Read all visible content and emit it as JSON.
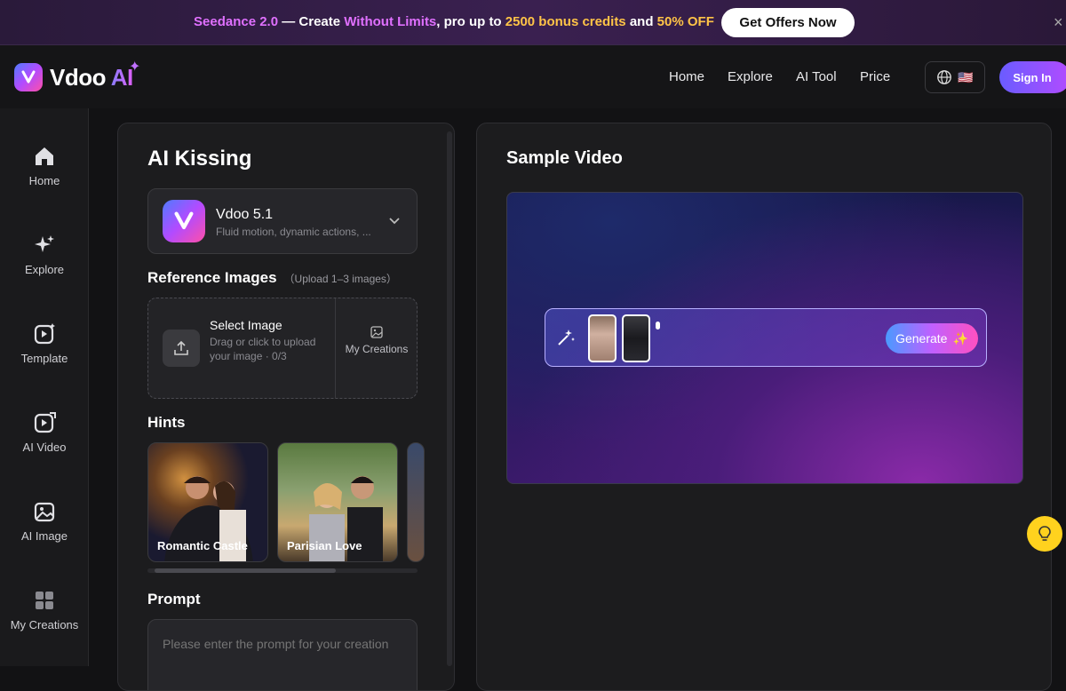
{
  "promo": {
    "brand": "Seedance 2.0",
    "dash": " — Create ",
    "highlight": "Without Limits",
    "mid": ", pro up to ",
    "credits": "2500 bonus credits",
    "and": " and ",
    "off": "50% OFF",
    "cta": "Get Offers Now",
    "close": "×"
  },
  "header": {
    "logo_main": "Vdoo ",
    "logo_ai": "AI",
    "nav": [
      "Home",
      "Explore",
      "AI Tool",
      "Price"
    ],
    "flag": "🇺🇸",
    "signin": "Sign In"
  },
  "sidebar": {
    "items": [
      {
        "label": "Home",
        "icon": "home-icon"
      },
      {
        "label": "Explore",
        "icon": "sparkle-icon"
      },
      {
        "label": "Template",
        "icon": "template-icon"
      },
      {
        "label": "AI Video",
        "icon": "ai-video-icon"
      },
      {
        "label": "AI Image",
        "icon": "ai-image-icon"
      },
      {
        "label": "My Creations",
        "icon": "grid-icon"
      }
    ]
  },
  "panel": {
    "title": "AI Kissing",
    "model_name": "Vdoo 5.1",
    "model_desc": "Fluid motion, dynamic actions, ...",
    "ref_title": "Reference Images",
    "ref_sub": "（Upload 1–3 images）",
    "upload_title": "Select Image",
    "upload_desc": "Drag or click to upload your image · 0/3",
    "my_creations": "My Creations",
    "hints_title": "Hints",
    "hints": [
      "Romantic Castle",
      "Parisian Love"
    ],
    "prompt_title": "Prompt",
    "prompt_placeholder": "Please enter the prompt for your creation"
  },
  "sample": {
    "title": "Sample Video",
    "generate": "Generate"
  },
  "colors": {
    "accent": "#b24bff",
    "gold": "#ffc447",
    "bulb": "#ffd21e"
  }
}
